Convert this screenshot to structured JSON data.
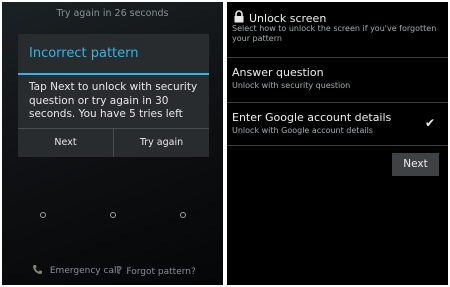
{
  "left": {
    "lock_message": "Try again in 26 seconds",
    "dialog": {
      "title": "Incorrect pattern",
      "body": "Tap Next to unlock with security question or try again in 30 seconds. You have 5 tries left",
      "next_label": "Next",
      "try_again_label": "Try again"
    },
    "emergency_label": "Emergency call",
    "forgot_label": "Forgot pattern?",
    "icons": {
      "phone": "phone-icon",
      "help": "question-mark-icon"
    }
  },
  "right": {
    "title": "Unlock screen",
    "subtitle": "Select how to unlock the screen if you've forgotten your pattern",
    "options": [
      {
        "title": "Answer question",
        "sub": "Unlock with security question",
        "selected": false
      },
      {
        "title": "Enter Google account details",
        "sub": "Unlock with Google account details",
        "selected": true
      }
    ],
    "next_label": "Next",
    "icons": {
      "lock": "lock-icon",
      "check": "checkmark-icon"
    }
  },
  "colors": {
    "accent": "#33b5e5",
    "background": "#000000",
    "dialog": "#282c2e"
  }
}
